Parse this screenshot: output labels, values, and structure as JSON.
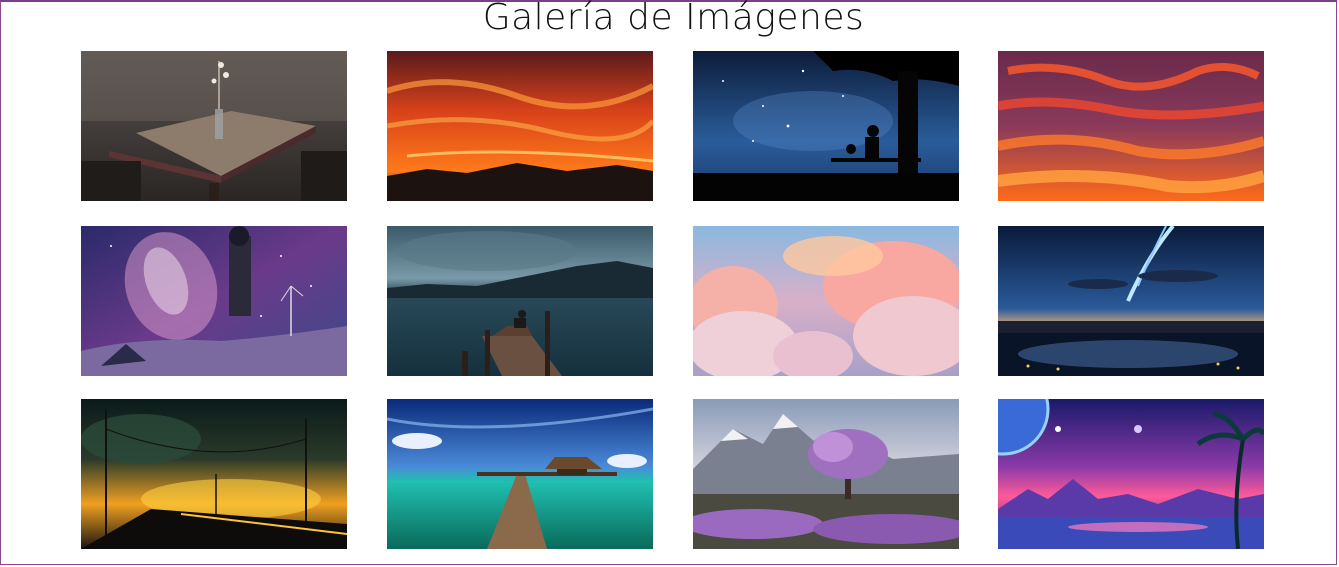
{
  "page": {
    "title": "Galería de Imágenes"
  },
  "gallery": {
    "images": [
      {
        "icon": "table-vase-rain-photo"
      },
      {
        "icon": "orange-sunset-sky-photo"
      },
      {
        "icon": "starry-night-tree-silhouette-photo"
      },
      {
        "icon": "red-clouds-sky-photo"
      },
      {
        "icon": "galaxy-anime-girl-photo"
      },
      {
        "icon": "lake-pier-person-photo"
      },
      {
        "icon": "pink-clouds-sky-photo"
      },
      {
        "icon": "comet-night-city-photo"
      },
      {
        "icon": "sunset-powerlines-road-photo"
      },
      {
        "icon": "tropical-pier-bungalow-photo"
      },
      {
        "icon": "purple-tree-mountains-photo"
      },
      {
        "icon": "neon-planet-palm-landscape-photo"
      }
    ]
  }
}
